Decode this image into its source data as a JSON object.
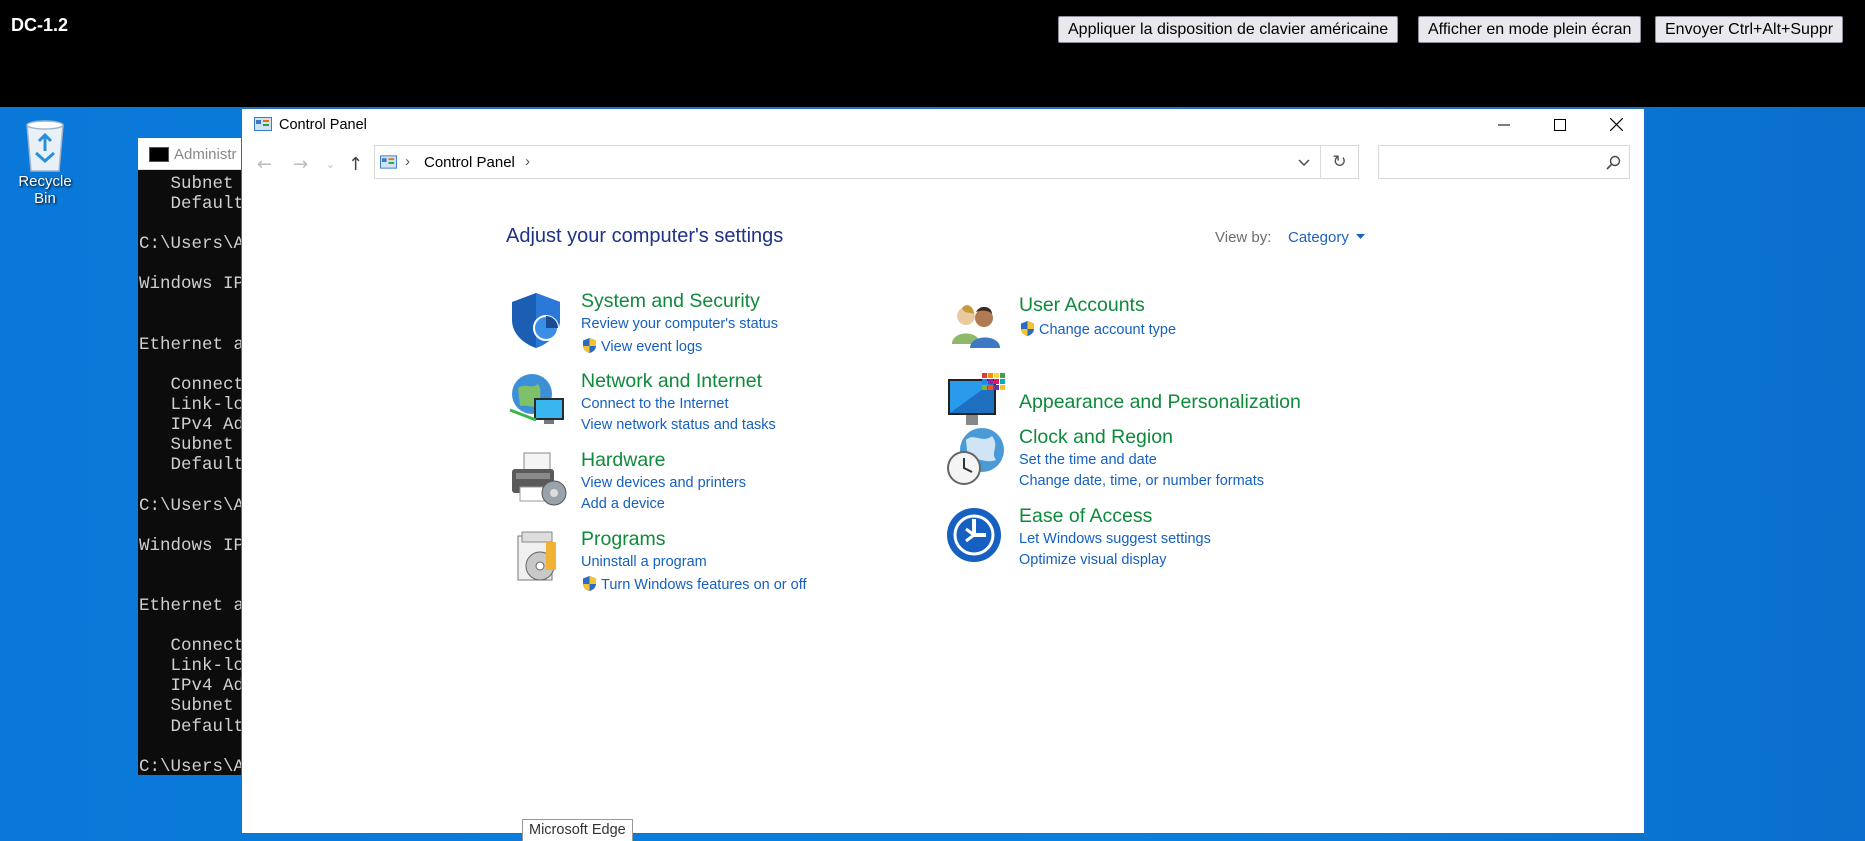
{
  "vm": {
    "title": "DC-1.2",
    "buttons": [
      "Appliquer la disposition de clavier américaine",
      "Afficher en mode plein écran",
      "Envoyer Ctrl+Alt+Suppr"
    ]
  },
  "desktop": {
    "recycle_bin_label": "Recycle Bin",
    "tooltip": "Microsoft Edge"
  },
  "cmd": {
    "title": "Administr",
    "lines": [
      "   Subnet ",
      "   Default",
      "",
      "C:\\Users\\A",
      "",
      "Windows IP",
      "",
      "",
      "Ethernet a",
      "",
      "   Connect",
      "   Link-lo",
      "   IPv4 Ad",
      "   Subnet ",
      "   Default",
      "",
      "C:\\Users\\A",
      "",
      "Windows IP",
      "",
      "",
      "Ethernet a",
      "",
      "   Connect",
      "   Link-lo",
      "   IPv4 Ad",
      "   Subnet ",
      "   Default",
      "",
      "C:\\Users\\A"
    ]
  },
  "control_panel": {
    "window_title": "Control Panel",
    "address": "Control Panel",
    "search_placeholder": "",
    "heading": "Adjust your computer's settings",
    "view_by_label": "View by:",
    "view_by_value": "Category",
    "categories": [
      {
        "title": "System and Security",
        "links": [
          "Review your computer's status",
          "View event logs"
        ]
      },
      {
        "title": "Network and Internet",
        "links": [
          "Connect to the Internet",
          "View network status and tasks"
        ]
      },
      {
        "title": "Hardware",
        "links": [
          "View devices and printers",
          "Add a device"
        ]
      },
      {
        "title": "Programs",
        "links": [
          "Uninstall a program",
          "Turn Windows features on or off"
        ]
      },
      {
        "title": "User Accounts",
        "links": [
          "Change account type"
        ]
      },
      {
        "title": "Appearance and Personalization",
        "links": []
      },
      {
        "title": "Clock and Region",
        "links": [
          "Set the time and date",
          "Change date, time, or number formats"
        ]
      },
      {
        "title": "Ease of Access",
        "links": [
          "Let Windows suggest settings",
          "Optimize visual display"
        ]
      }
    ]
  },
  "colors": {
    "desktop": "#0078d7",
    "category_title": "#0e8a3b",
    "link": "#1560c0",
    "heading": "#1e3287"
  }
}
